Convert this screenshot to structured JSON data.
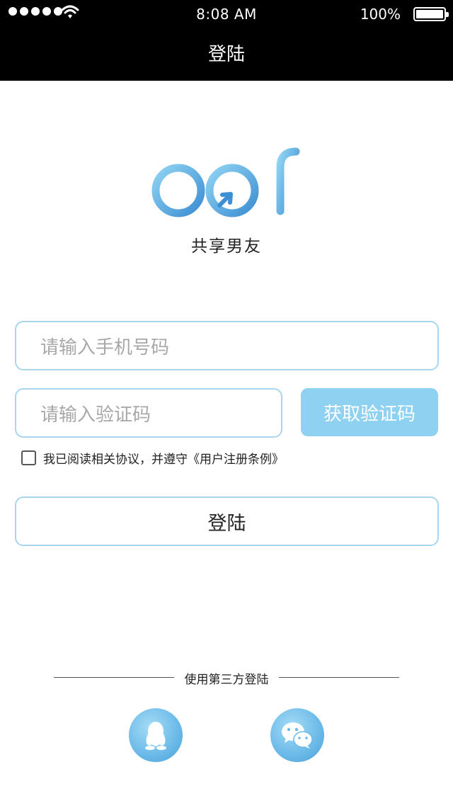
{
  "status_bar": {
    "time": "8:08 AM",
    "battery": "100%",
    "icons": [
      "signal-dots-icon",
      "wifi-icon",
      "battery-icon"
    ]
  },
  "nav": {
    "title": "登陆"
  },
  "brand": {
    "logo_text": "bof",
    "tagline": "共享男友",
    "logo_colors": [
      "#7cc6ef",
      "#3d8fd3"
    ]
  },
  "form": {
    "phone_placeholder": "请输入手机号码",
    "code_placeholder": "请输入验证码",
    "get_code_label": "获取验证码",
    "agreement_text": "我已阅读相关协议，并遵守《用户注册条例》",
    "agreement_checked": false,
    "login_label": "登陆"
  },
  "third_party": {
    "label": "使用第三方登陆",
    "providers": [
      {
        "name": "qq",
        "icon": "qq-penguin-icon"
      },
      {
        "name": "wechat",
        "icon": "wechat-icon"
      }
    ]
  },
  "colors": {
    "accent": "#8fd1f0",
    "border": "#a9d6ee",
    "header_bg": "#000000"
  }
}
